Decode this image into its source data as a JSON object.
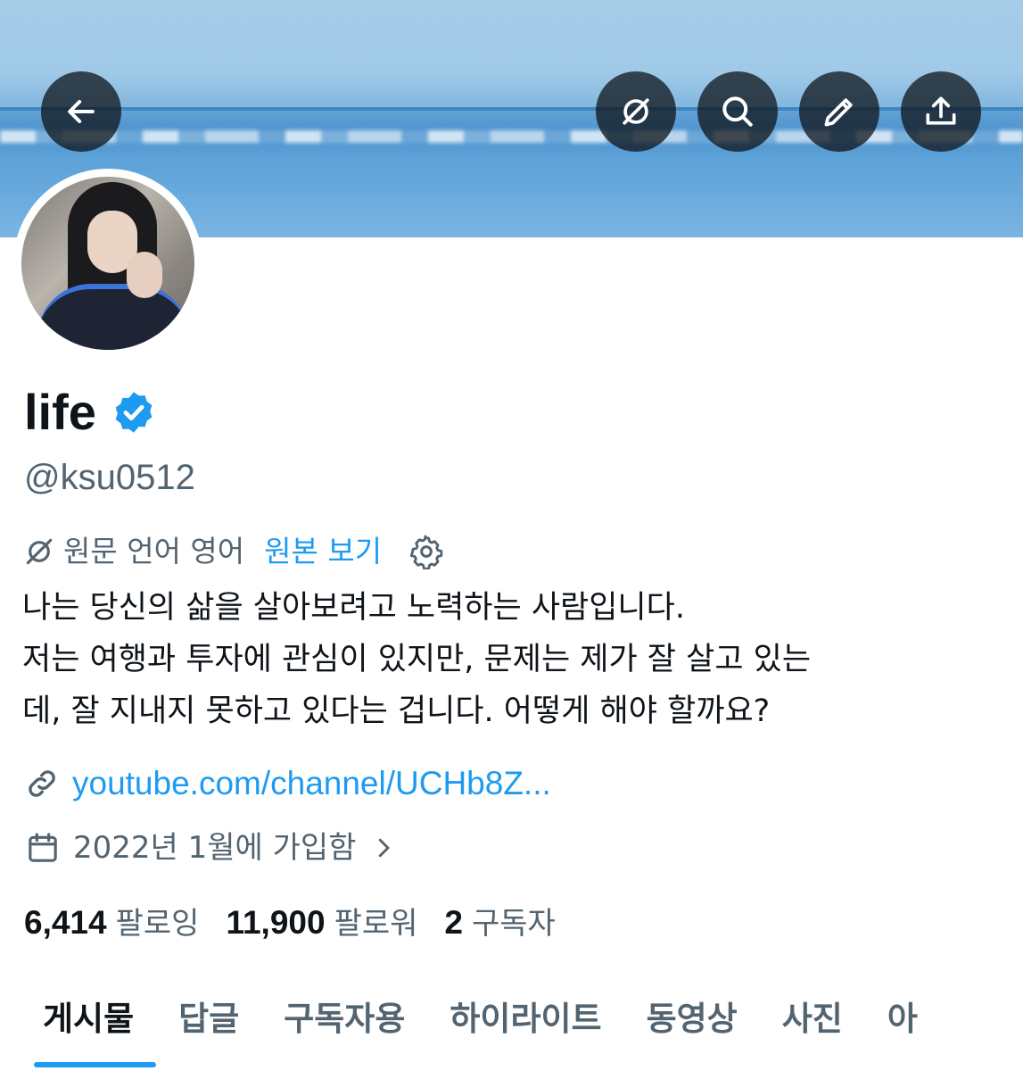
{
  "header": {
    "back": "back-icon",
    "actions": [
      "translate-off-icon",
      "search-icon",
      "edit-icon",
      "share-icon"
    ]
  },
  "profile": {
    "name": "life",
    "handle": "@ksu0512",
    "verified_color": "#1d9bf0"
  },
  "translation": {
    "source": "원문 언어 영어",
    "view_original": "원본 보기"
  },
  "bio": {
    "line1": "나는 당신의 삶을 살아보려고 노력하는 사람입니다.",
    "line2": "저는 여행과 투자에 관심이 있지만, 문제는 제가 잘 살고 있는",
    "line3": "데, 잘 지내지 못하고 있다는 겁니다. 어떻게 해야 할까요?"
  },
  "link": "youtube.com/channel/UCHb8Z...",
  "joined": "2022년 1월에 가입함",
  "stats": {
    "following_count": "6,414",
    "following_label": "팔로잉",
    "followers_count": "11,900",
    "followers_label": "팔로워",
    "subscribers_count": "2",
    "subscribers_label": "구독자"
  },
  "tabs": [
    "게시물",
    "답글",
    "구독자용",
    "하이라이트",
    "동영상",
    "사진",
    "아"
  ],
  "colors": {
    "accent": "#1d9bf0",
    "secondary_text": "#536471",
    "primary_text": "#0f1419"
  }
}
